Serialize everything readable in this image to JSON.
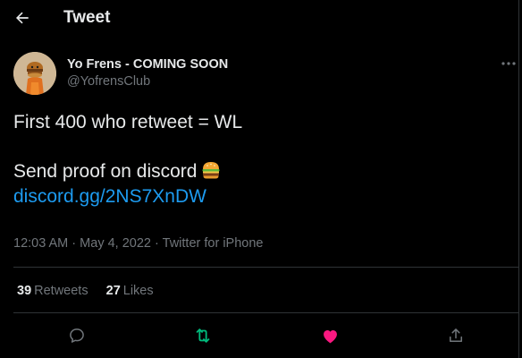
{
  "header": {
    "title": "Tweet"
  },
  "author": {
    "name": "Yo Frens - COMING SOON",
    "handle": "@YofrensClub"
  },
  "tweet": {
    "line1": "First 400 who retweet = WL",
    "line2": "Send proof on discord",
    "link": "discord.gg/2NS7XnDW"
  },
  "meta": {
    "time": "12:03 AM",
    "separator": "·",
    "date": "May 4, 2022",
    "source": "Twitter for iPhone"
  },
  "stats": {
    "retweets_count": "39",
    "retweets_label": "Retweets",
    "likes_count": "27",
    "likes_label": "Likes"
  },
  "colors": {
    "background": "#000000",
    "text": "#e7e9ea",
    "secondary": "#71767b",
    "link": "#1d9bf0",
    "retweeted": "#00ba7c",
    "liked": "#f91880",
    "border": "#2f3336"
  },
  "icons": {
    "back": "arrow-left-icon",
    "more": "more-horizontal-icon",
    "reply": "reply-icon",
    "retweet": "retweet-icon",
    "like": "heart-icon",
    "share": "share-icon",
    "emoji": "burger-emoji"
  }
}
